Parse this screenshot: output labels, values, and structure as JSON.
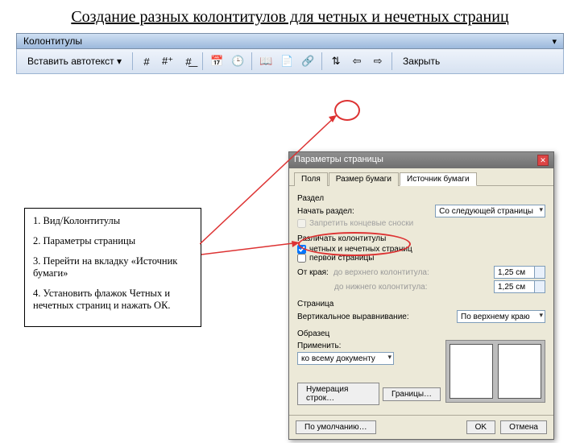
{
  "title": "Создание разных колонтитулов для четных и нечетных страниц",
  "toolbar": {
    "palette_title": "Колонтитулы",
    "autotext": "Вставить автотекст",
    "close": "Закрыть"
  },
  "steps": {
    "s1": "1. Вид/Колонтитулы",
    "s2": "2. Параметры страницы",
    "s3": "3. Перейти на вкладку «Источник бумаги»",
    "s4": "4. Установить флажок Четных и нечетных страниц и нажать ОК."
  },
  "dialog": {
    "title": "Параметры страницы",
    "tabs": {
      "t1": "Поля",
      "t2": "Размер бумаги",
      "t3": "Источник бумаги"
    },
    "section_label": "Раздел",
    "section_start": "Начать раздел:",
    "section_start_value": "Со следующей страницы",
    "suppress_endnotes": "Запретить концевые сноски",
    "headers_label": "Различать колонтитулы",
    "chk_oddeven": "четных и нечетных страниц",
    "chk_first": "первой страницы",
    "from_edge": "От края:",
    "to_header": "до верхнего колонтитула:",
    "to_footer": "до нижнего колонтитула:",
    "dist_header": "1,25 см",
    "dist_footer": "1,25 см",
    "page_label": "Страница",
    "valign": "Вертикальное выравнивание:",
    "valign_value": "По верхнему краю",
    "preview_label": "Образец",
    "apply_label": "Применить:",
    "apply_value": "ко всему документу",
    "line_numbers": "Нумерация строк…",
    "borders": "Границы…",
    "default": "По умолчанию…",
    "ok": "OK",
    "cancel": "Отмена"
  }
}
